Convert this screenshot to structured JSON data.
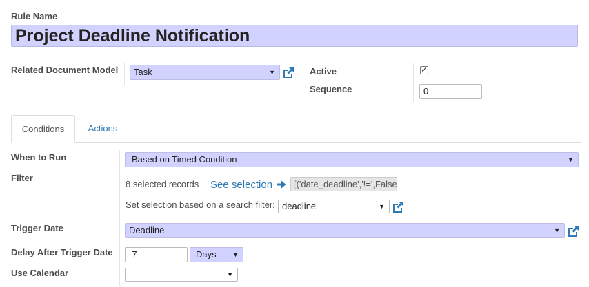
{
  "form": {
    "rule_name_label": "Rule Name",
    "rule_name_value": "Project Deadline Notification",
    "model_label": "Related Document Model",
    "model_value": "Task",
    "active_label": "Active",
    "active_checked": true,
    "sequence_label": "Sequence",
    "sequence_value": "0"
  },
  "tabs": [
    {
      "label": "Conditions",
      "active": true
    },
    {
      "label": "Actions",
      "active": false
    }
  ],
  "conditions": {
    "when_to_run_label": "When to Run",
    "when_to_run_value": "Based on Timed Condition",
    "filter_label": "Filter",
    "selected_records": "8 selected records",
    "see_selection": "See selection",
    "domain_value": "[('date_deadline','!=',False",
    "search_filter_label": "Set selection based on a search filter:",
    "search_filter_value": "deadline",
    "trigger_date_label": "Trigger Date",
    "trigger_date_value": "Deadline",
    "delay_label": "Delay After Trigger Date",
    "delay_value": "-7",
    "delay_unit": "Days",
    "calendar_label": "Use Calendar",
    "calendar_value": ""
  },
  "icons": {
    "external": "external-link-icon",
    "caret": "caret-down-icon",
    "arrow": "arrow-right-icon",
    "check": "checkmark-icon"
  },
  "colors": {
    "required_field": "#d2d2ff",
    "link": "#2f7ab3"
  }
}
